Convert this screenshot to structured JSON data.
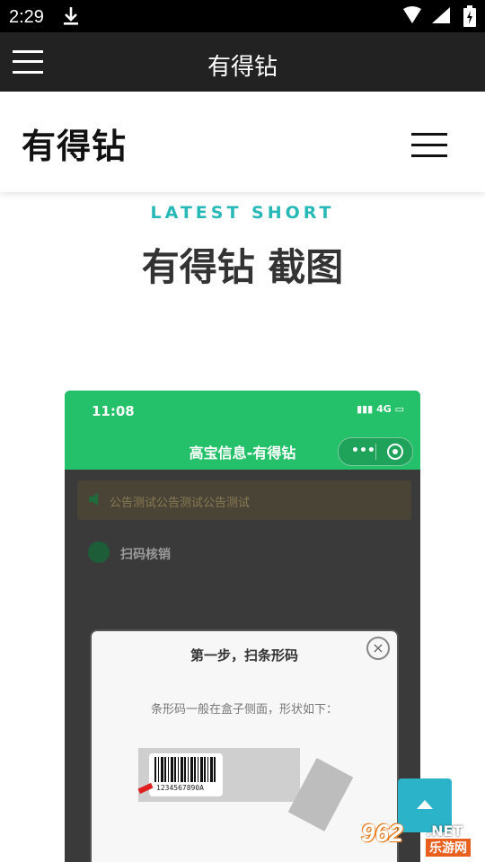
{
  "statusbar": {
    "time": "2:29"
  },
  "appbar": {
    "title": "有得钻"
  },
  "site": {
    "logo": "有得钻"
  },
  "section": {
    "kicker": "LATEST SHORT",
    "heading": "有得钻 截图"
  },
  "screenshot": {
    "time": "11:08",
    "network": "4G",
    "title": "高宝信息-有得钻",
    "notice": "公告测试公告测试公告测试",
    "scan_label": "扫码核销",
    "dialog": {
      "title": "第一步，扫条形码",
      "description": "条形码一般在盒子侧面，形状如下：",
      "barcode_number": "1234567890A"
    },
    "accent": "#25c06a"
  },
  "watermark": {
    "number": "962",
    "net": ".NET",
    "cn": "乐游网"
  },
  "colors": {
    "kicker": "#29b8b8",
    "back_to_top": "#2bb3c9"
  }
}
